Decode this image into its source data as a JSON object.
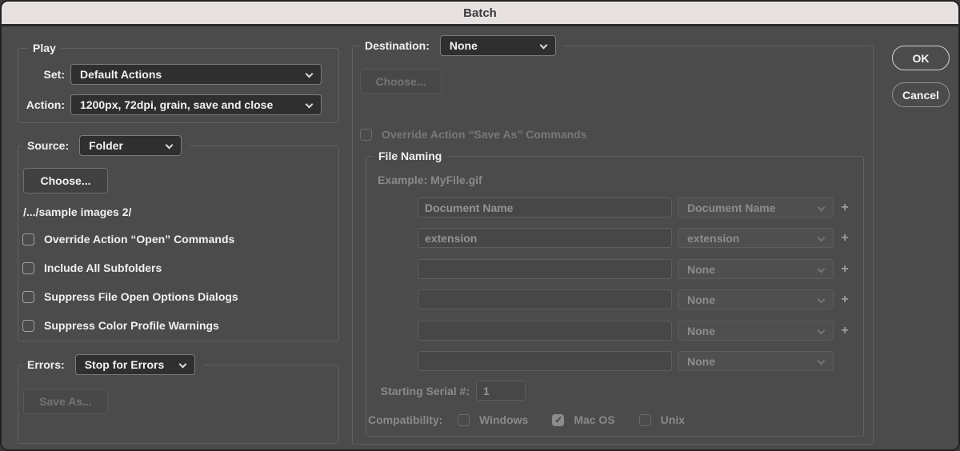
{
  "window": {
    "title": "Batch"
  },
  "colors": {
    "dialog_bg": "#4b4b4b",
    "titlebar_bg": "#e7e2e1",
    "enabled_text": "#f0f0f0",
    "disabled_text": "#8a8a8a",
    "dropdown_bg": "#2f2f2f",
    "group_border": "#616161"
  },
  "play": {
    "legend": "Play",
    "set_label": "Set:",
    "set_value": "Default Actions",
    "action_label": "Action:",
    "action_value": "1200px, 72dpi, grain, save and close"
  },
  "source": {
    "legend": "Source:",
    "value": "Folder",
    "choose_label": "Choose...",
    "path": "/.../sample images 2/",
    "checkboxes": [
      {
        "label": "Override Action “Open” Commands",
        "checked": false
      },
      {
        "label": "Include All Subfolders",
        "checked": false
      },
      {
        "label": "Suppress File Open Options Dialogs",
        "checked": false
      },
      {
        "label": "Suppress Color Profile Warnings",
        "checked": false
      }
    ]
  },
  "errors": {
    "legend": "Errors:",
    "value": "Stop for Errors",
    "save_as_label": "Save As..."
  },
  "destination": {
    "legend": "Destination:",
    "value": "None",
    "choose_label": "Choose...",
    "override": {
      "label": "Override Action “Save As” Commands",
      "checked": false
    }
  },
  "file_naming": {
    "legend": "File Naming",
    "example": "Example: MyFile.gif",
    "plus_glyph": "+",
    "rows": [
      {
        "field": "Document Name",
        "select": "Document Name",
        "plus": true
      },
      {
        "field": "extension",
        "select": "extension",
        "plus": true
      },
      {
        "field": "",
        "select": "None",
        "plus": true
      },
      {
        "field": "",
        "select": "None",
        "plus": true
      },
      {
        "field": "",
        "select": "None",
        "plus": true
      },
      {
        "field": "",
        "select": "None",
        "plus": false
      }
    ],
    "starting_serial_label": "Starting Serial #:",
    "starting_serial_value": "1",
    "compatibility": {
      "label": "Compatibility:",
      "options": [
        {
          "label": "Windows",
          "checked": false
        },
        {
          "label": "Mac OS",
          "checked": true
        },
        {
          "label": "Unix",
          "checked": false
        }
      ]
    }
  },
  "actions": {
    "ok": "OK",
    "cancel": "Cancel"
  }
}
